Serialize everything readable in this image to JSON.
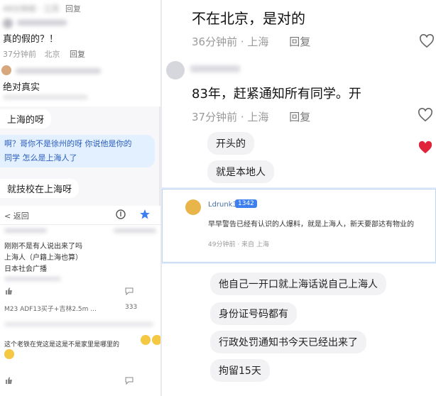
{
  "top_left": {
    "header_meta": "48分钟前 · 江苏",
    "header_reply": "回复",
    "comment1_text": "真的假的？！",
    "comment1_time": "37分钟前",
    "comment1_loc": "北京",
    "comment1_reply": "回复",
    "comment2_text": "绝对真实"
  },
  "chat_left": {
    "msg_shanghai": "上海的呀",
    "msg_blue_line1": "啊？哥你不是徐州的呀 你说他是你的",
    "msg_blue_line2": "同学 怎么是上海人了",
    "msg_school": "就技校在上海呀"
  },
  "mini_app": {
    "back_label": "< 返回",
    "line1": "刚刚不是有人说出来了吗",
    "line2": "上海人（户籍上海也算）",
    "line3": "日本社会广播",
    "sub_line": "M23 ADF13买子+吉林2.5m ...",
    "count": "333",
    "bottom_text": "这个老铁在党这是这是不是家里是哪里的"
  },
  "right": {
    "top_text": "不在北京，是对的",
    "top_time": "36分钟前 · 上海",
    "top_reply": "回复",
    "comment_text": "83年，赶紧通知所有同学。开",
    "comment_time": "37分钟前 · 上海",
    "comment_reply": "回复",
    "bubble_start": "开头的",
    "bubble_local": "就是本地人",
    "popup_user": "Ldrunk3",
    "popup_badge": "1342",
    "popup_text": "早早警告已经有认识的人爆料，就是上海人，新天要部达有物业的",
    "popup_meta": "49分钟前 · 来自 上海",
    "bubble1": "他自己一开口就上海话说自己上海人",
    "bubble2": "身份证号码都有",
    "bubble3": "行政处罚通知书今天已经出来了",
    "bubble4": "拘留15天"
  },
  "colors": {
    "blue_bubble": "#e3f0ff",
    "blue_text": "#2a5dbf",
    "heart_red": "#e0243c",
    "accent_blue": "#3d7ff0"
  }
}
